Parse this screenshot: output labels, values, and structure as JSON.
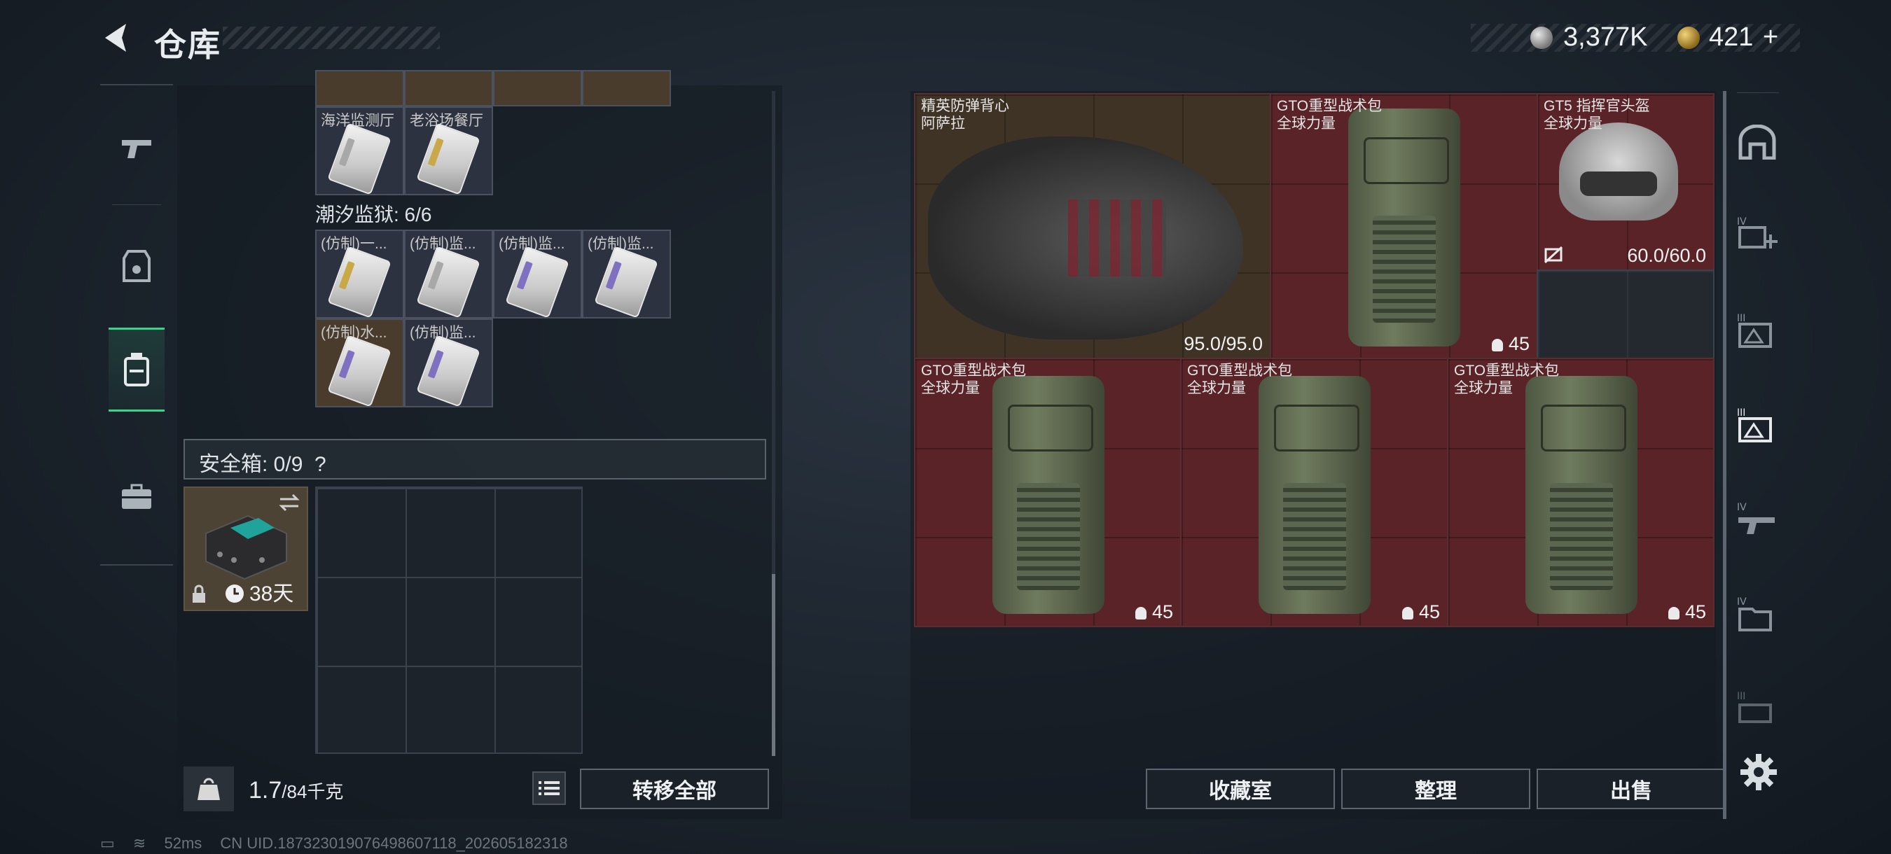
{
  "header": {
    "title": "仓库",
    "currency_silver": "3,377K",
    "currency_gold": "421",
    "add_symbol": "+"
  },
  "left_tabs": [
    {
      "name": "weapons"
    },
    {
      "name": "equipment"
    },
    {
      "name": "backpack",
      "active": true
    },
    {
      "name": "toolbox"
    }
  ],
  "cards_top": {
    "row_labels": [
      "海洋监测厅",
      "老浴场餐厅"
    ]
  },
  "section_prison": {
    "title": "潮汐监狱: 6/6",
    "items": [
      "(仿制)一...",
      "(仿制)监...",
      "(仿制)监...",
      "(仿制)监...",
      "(仿制)水...",
      "(仿制)监..."
    ]
  },
  "safebox": {
    "title": "安全箱: 0/9",
    "help": "?",
    "duration": "38天"
  },
  "weight": {
    "current": "1.7",
    "capacity": "/84千克"
  },
  "left_buttons": {
    "transfer_all": "转移全部"
  },
  "right_items": [
    {
      "name": "精英防弹背心",
      "sub": "阿萨拉",
      "value": "95.0/95.0"
    },
    {
      "name": "GTO重型战术包",
      "sub": "全球力量",
      "value": "45"
    },
    {
      "name": "GT5 指挥官头盔",
      "sub": "全球力量",
      "value": "60.0/60.0"
    },
    {
      "name": "GTO重型战术包",
      "sub": "全球力量",
      "value": "45"
    },
    {
      "name": "GTO重型战术包",
      "sub": "全球力量",
      "value": "45"
    },
    {
      "name": "GTO重型战术包",
      "sub": "全球力量",
      "value": "45"
    }
  ],
  "right_buttons": {
    "collection": "收藏室",
    "organize": "整理",
    "sell": "出售"
  },
  "right_tabs": [
    "IV",
    "III",
    "III",
    "IV",
    "IV",
    "III"
  ],
  "footer": {
    "ping": "52ms",
    "uid": "CN UID.18732301907649860​7118_202605182318"
  },
  "colors": {
    "accent_green": "#39d48c",
    "item_red": "#5a2328",
    "item_brown": "#3f3326"
  }
}
